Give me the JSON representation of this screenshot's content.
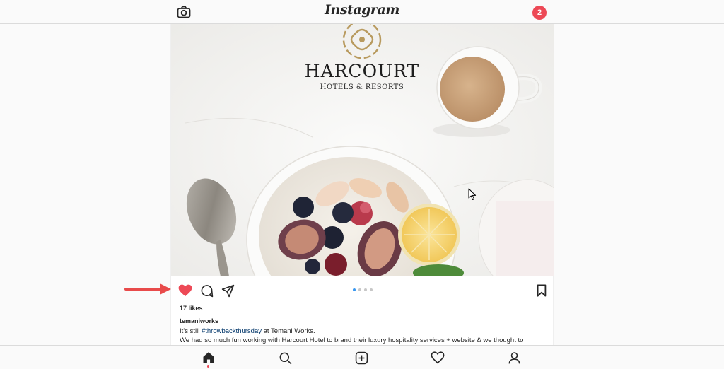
{
  "header": {
    "brand": "Instagram",
    "camera_icon": "camera-icon",
    "notification_count": "2",
    "notification_color": "#ed4956"
  },
  "post": {
    "image": {
      "logo_title": "HARCOURT",
      "logo_subtitle": "HOTELS & RESORTS",
      "logo_color": "#b89a5e"
    },
    "carousel": {
      "total": 4,
      "active_index": 0,
      "active_color": "#3897f0"
    },
    "actions": {
      "like_icon": "heart-filled-icon",
      "liked": true,
      "like_color": "#ed4956",
      "comment_icon": "comment-icon",
      "share_icon": "send-icon",
      "save_icon": "bookmark-icon"
    },
    "likes": "17 likes",
    "username": "temaniworks",
    "caption": {
      "before": "It’s still ",
      "hashtag": "#throwbackthursday",
      "after": " at Temani Works.",
      "line2": "We had so much fun working with Harcourt Hotel to brand their luxury hospitality services + website & we thought to"
    }
  },
  "annotation": {
    "arrow_color": "#e84a4a"
  },
  "bottom_nav": {
    "items": [
      {
        "icon": "home-icon"
      },
      {
        "icon": "search-icon"
      },
      {
        "icon": "add-post-icon"
      },
      {
        "icon": "activity-heart-icon"
      },
      {
        "icon": "profile-icon"
      }
    ],
    "active_indicator_color": "#ed4956"
  }
}
